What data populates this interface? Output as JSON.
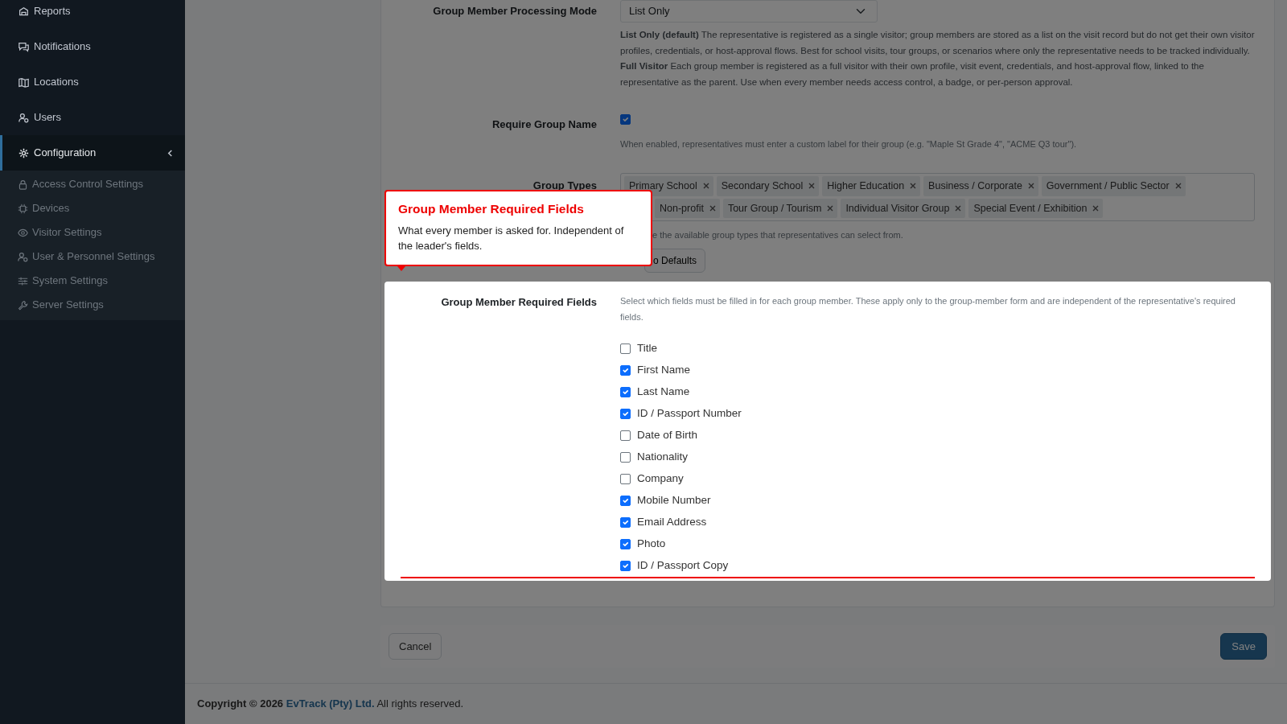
{
  "sidebar": {
    "items": [
      {
        "label": "Reports",
        "selected": false
      },
      {
        "label": "Notifications",
        "selected": false
      },
      {
        "label": "Locations",
        "selected": false
      },
      {
        "label": "Users",
        "selected": false
      },
      {
        "label": "Configuration",
        "selected": true,
        "expanded": true,
        "children": [
          {
            "label": "Access Control Settings",
            "selected": false
          },
          {
            "label": "Devices",
            "selected": false
          },
          {
            "label": "Visitor Settings",
            "selected": false
          },
          {
            "label": "User & Personnel Settings",
            "selected": false
          },
          {
            "label": "System Settings",
            "selected": false
          },
          {
            "label": "Server Settings",
            "selected": false
          }
        ]
      }
    ]
  },
  "form": {
    "processing_mode": {
      "label": "Group Member Processing Mode",
      "value": "List Only",
      "descriptions": [
        "**List Only (default)** The representative is registered as a single visitor; group members are stored as a list on the visit record but do not get their own visitor profiles, credentials, or host-approval flows. Best for school visits, tour groups, or scenarios where only the representative needs to be tracked individually.",
        "**Full Visitor** Each group member is registered as a full visitor with their own profile, visit event, credentials, and host-approval flow, linked to the representative as the parent. Use when every member needs access control, a badge, or per-person approval."
      ]
    },
    "require_group_name": {
      "label": "Require Group Name",
      "checked": true,
      "hint": "When enabled, representatives must enter a custom label for their group (e.g. \"Maple St Grade 4\", \"ACME Q3 tour\")."
    },
    "group_types": {
      "label": "Group Types",
      "tags": [
        "Primary School",
        "Secondary School",
        "Higher Education",
        "Business / Corporate",
        "Government / Public Sector",
        "Non-profit",
        "Tour Group / Tourism",
        "Individual Visitor Group",
        "Special Event / Exhibition"
      ],
      "hint": "e the available group types that representatives can select from.",
      "button": "o Defaults"
    },
    "required_fields": {
      "label": "Group Member Required Fields",
      "hint": "Select which fields must be filled in for each group member. These apply only to the group-member form and are independent of the representative's required fields.",
      "fields": [
        {
          "label": "Title",
          "checked": false
        },
        {
          "label": "First Name",
          "checked": true
        },
        {
          "label": "Last Name",
          "checked": true
        },
        {
          "label": "ID / Passport Number",
          "checked": true
        },
        {
          "label": "Date of Birth",
          "checked": false
        },
        {
          "label": "Nationality",
          "checked": false
        },
        {
          "label": "Company",
          "checked": false
        },
        {
          "label": "Mobile Number",
          "checked": true
        },
        {
          "label": "Email Address",
          "checked": true
        },
        {
          "label": "Photo",
          "checked": true
        },
        {
          "label": "ID / Passport Copy",
          "checked": true
        }
      ]
    }
  },
  "actions": {
    "cancel": "Cancel",
    "save": "Save"
  },
  "tour": {
    "title": "Group Member Required Fields",
    "body": "What every member is asked for. Independent of the leader's fields."
  },
  "footer": {
    "prefix": "**Copyright © 2026**",
    "link": "EvTrack (Pty) Ltd.",
    "suffix": "All rights reserved."
  }
}
